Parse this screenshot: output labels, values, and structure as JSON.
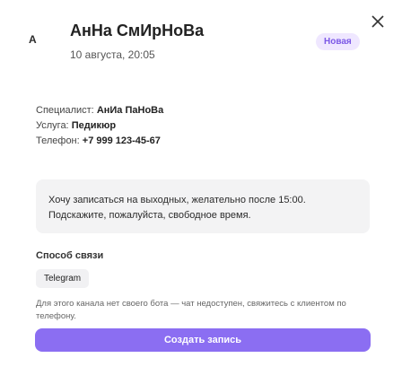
{
  "header": {
    "avatar_letter": "А",
    "client_name": "АнНа СмИрНоВа",
    "datetime": "10 августа, 20:05",
    "status_badge": "Новая",
    "status_color": "#7b58e6"
  },
  "details": {
    "specialist_label": "Специалист:",
    "specialist_value": "АнИа ПаНоВа",
    "service_label": "Услуга:",
    "service_value": "Педикюр",
    "phone_label": "Телефон:",
    "phone_value": "+7 999 123-45-67"
  },
  "message": "Хочу записаться на выходных, желательно после 15:00. Подскажите, пожалуйста, свободное время.",
  "contact": {
    "title": "Способ связи",
    "method": "Telegram",
    "note": "Для этого канала нет своего бота — чат недоступен, свяжитесь с клиентом по телефону."
  },
  "actions": {
    "create_label": "Создать запись",
    "accent_color": "#8b6ef2"
  },
  "icons": {
    "close": "close-icon"
  }
}
